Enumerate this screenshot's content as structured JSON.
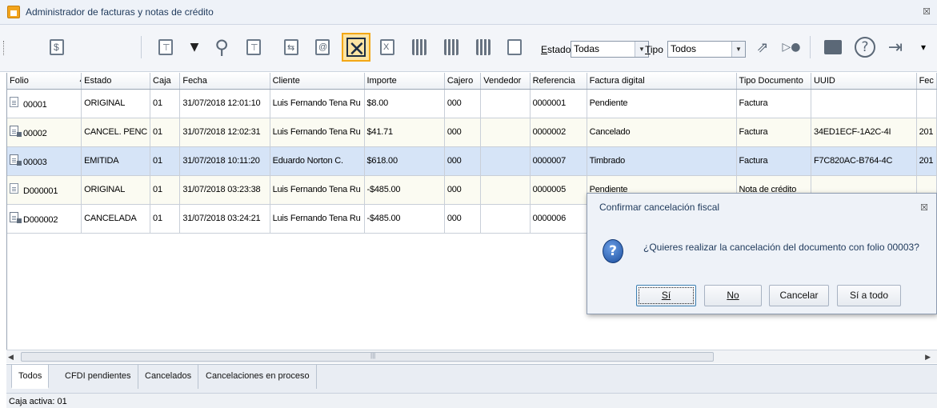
{
  "window": {
    "title": "Administrador de facturas y notas de crédito",
    "close_glyph": "☒",
    "icon": "app-icon"
  },
  "toolbar": {
    "estado_label": "Estado",
    "estado_value": "Todas",
    "tipo_label": "Tipo",
    "tipo_value": "Todos",
    "overflow_glyph": "▾",
    "icons": [
      "new-invoice-icon",
      "payment-icon",
      "invoice-search-icon",
      "invoice-list-icon",
      "filter-icon",
      "filter-dropdown-icon",
      "search-icon",
      "filter-clear-icon",
      "transfer-icon",
      "email-icon",
      "cancel-document-icon",
      "excel-export-icon",
      "qr-search-icon",
      "qr-icon",
      "qr-cancel-icon",
      "document-export-icon",
      "export-arrow-icon",
      "printer-icon",
      "help-icon",
      "exit-icon"
    ]
  },
  "grid": {
    "columns": [
      "Folio",
      "Estado",
      "Caja",
      "Fecha",
      "Cliente",
      "Importe",
      "Cajero",
      "Vendedor",
      "Referencia",
      "Factura digital",
      "Tipo Documento",
      "UUID",
      "Fec"
    ],
    "rows": [
      {
        "icon": "document-icon",
        "folio": "00001",
        "estado": "ORIGINAL",
        "caja": "01",
        "fecha": "31/07/2018 12:01:10",
        "cliente": "Luis Fernando Tena Ru",
        "importe": "$8.00",
        "cajero": "000",
        "vendedor": "",
        "referencia": "0000001",
        "factura_digital": "Pendiente",
        "tipo": "Factura",
        "uuid": "",
        "fec": ""
      },
      {
        "icon": "stamped-document-icon",
        "folio": "00002",
        "estado": "CANCEL. PENC",
        "caja": "01",
        "fecha": "31/07/2018 12:02:31",
        "cliente": "Luis Fernando Tena Ru",
        "importe": "$41.71",
        "cajero": "000",
        "vendedor": "",
        "referencia": "0000002",
        "factura_digital": "Cancelado",
        "tipo": "Factura",
        "uuid": "34ED1ECF-1A2C-4I",
        "fec": "201"
      },
      {
        "icon": "stamped-document-icon",
        "folio": "00003",
        "estado": "EMITIDA",
        "caja": "01",
        "fecha": "31/07/2018 10:11:20",
        "cliente": "Eduardo Norton C.",
        "importe": "$618.00",
        "cajero": "000",
        "vendedor": "",
        "referencia": "0000007",
        "factura_digital": "Timbrado",
        "tipo": "Factura",
        "uuid": "F7C820AC-B764-4C",
        "fec": "201"
      },
      {
        "icon": "document-icon",
        "folio": "D000001",
        "estado": "ORIGINAL",
        "caja": "01",
        "fecha": "31/07/2018 03:23:38",
        "cliente": "Luis Fernando Tena Ru",
        "importe": "-$485.00",
        "cajero": "000",
        "vendedor": "",
        "referencia": "0000005",
        "factura_digital": "Pendiente",
        "tipo": "Nota de crédito",
        "uuid": "",
        "fec": ""
      },
      {
        "icon": "stamped-document-icon",
        "folio": "D000002",
        "estado": "CANCELADA",
        "caja": "01",
        "fecha": "31/07/2018 03:24:21",
        "cliente": "Luis Fernando Tena Ru",
        "importe": "-$485.00",
        "cajero": "000",
        "vendedor": "",
        "referencia": "0000006",
        "factura_digital": "",
        "tipo": "",
        "uuid": "",
        "fec": ""
      }
    ]
  },
  "tabs": [
    "Todos",
    "CFDI pendientes",
    "Cancelados",
    "Cancelaciones en proceso"
  ],
  "status": {
    "text": "Caja activa: 01"
  },
  "dialog": {
    "title": "Confirmar cancelación fiscal",
    "message": "¿Quieres realizar la cancelación del documento con folio 00003?",
    "icon_glyph": "?",
    "buttons": {
      "yes": "Sí",
      "no": "No",
      "cancel": "Cancelar",
      "yes_all": "Sí a todo"
    }
  },
  "colors": {
    "selection": "#d6e4f7",
    "active_tool": "#f3a716",
    "title_text": "#1e395b"
  }
}
